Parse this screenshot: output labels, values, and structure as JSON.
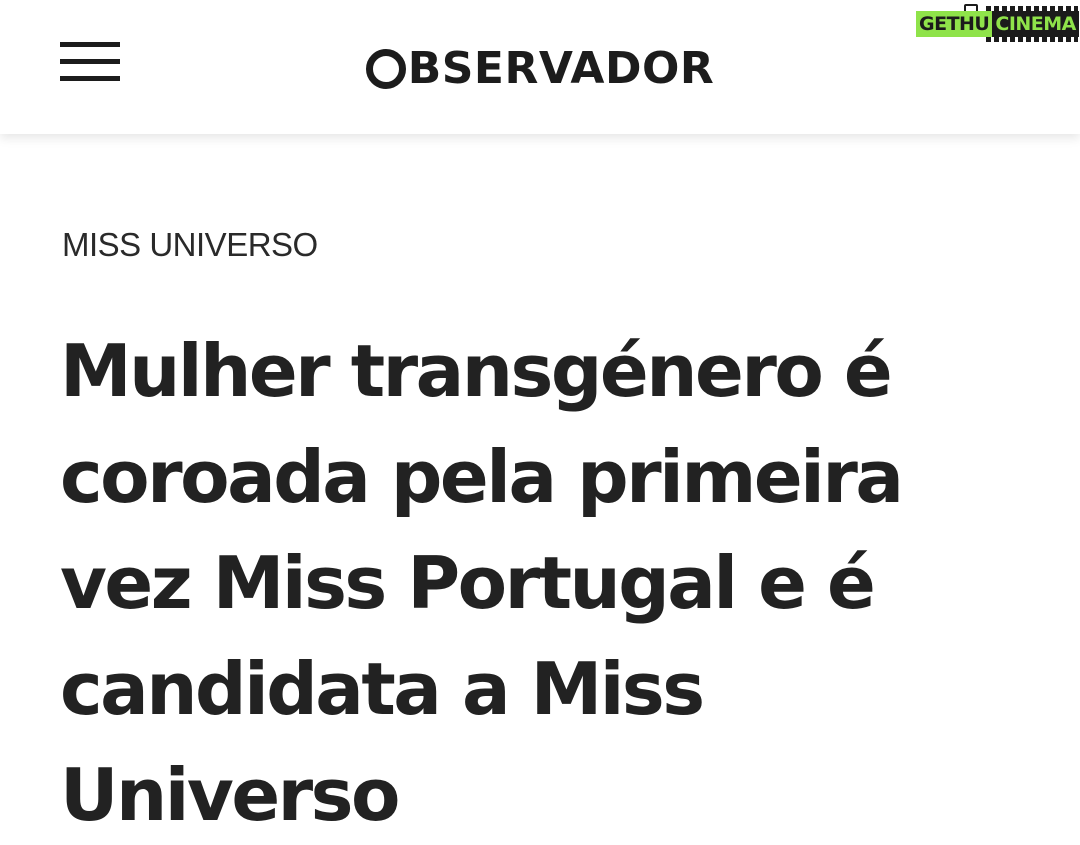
{
  "header": {
    "menu_icon": "hamburger-menu-icon",
    "logo_text": "BSERVADOR",
    "logo_letter_icon": "ring-o-icon"
  },
  "watermark": {
    "part1": "GETHU",
    "part2": "CINEMA",
    "icon": "film-camera-icon",
    "colors": {
      "green": "#8fe34a",
      "dark": "#1b1b1b"
    }
  },
  "article": {
    "kicker": "MISS UNIVERSO",
    "headline": "Mulher transgénero é coroada pela primeira vez Miss Portugal e é candidata a Miss Universo"
  },
  "colors": {
    "background": "#ffffff",
    "text": "#222222"
  }
}
